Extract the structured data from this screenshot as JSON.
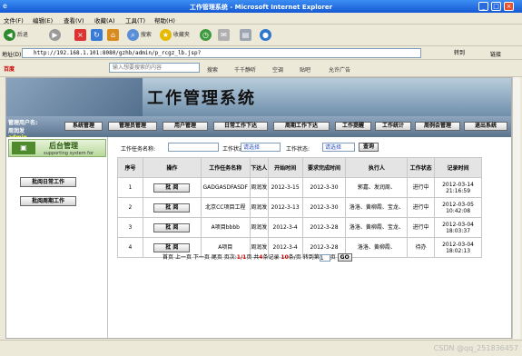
{
  "window": {
    "title": "工作管理系统 - Microsoft Internet Explorer",
    "controls": [
      "_",
      "□",
      "×"
    ]
  },
  "menu": [
    "文件(F)",
    "编辑(E)",
    "查看(V)",
    "收藏(A)",
    "工具(T)",
    "帮助(H)"
  ],
  "toolbar": {
    "back": "后退",
    "search": "搜索",
    "favorites": "收藏夹"
  },
  "address": {
    "label": "地址(D)",
    "url": "http://192.168.1.101:8080/gzhb/admin/p_rcgz_lb.jsp?",
    "go": "转到",
    "links": "链接"
  },
  "searchbar": {
    "brand": "百度",
    "placeholder": "输入想要搜索的内容",
    "items": [
      "搜索",
      "千千静听",
      "空调",
      "贴吧",
      "允许广告"
    ]
  },
  "app": {
    "title": "工作管理系统",
    "user_label": "管理用户名:",
    "user_role": "周润发",
    "user_name": "admin",
    "nav": [
      "系统管理",
      "管理员管理",
      "用户管理",
      "日常工作下达",
      "周期工作下达",
      "工作提醒",
      "工作统计",
      "周例会管理",
      "退出系统"
    ],
    "side": {
      "title": "后台管理",
      "subtitle": "supporting system for",
      "buttons": [
        "批阅日常工作",
        "批阅周期工作"
      ]
    },
    "filter": {
      "name_label": "工作任务名称:",
      "status1_label": "工作状态:",
      "status1_value": "请选择",
      "status2_label": "工作状态:",
      "status2_value": "请选择",
      "query": "查询"
    },
    "table": {
      "headers": [
        "序号",
        "操作",
        "工作任务名称",
        "下达人",
        "开始时间",
        "要求完成时间",
        "执行人",
        "工作状态",
        "记录时间"
      ],
      "action_label": "批 阅",
      "rows": [
        {
          "no": "1",
          "name": "GADGASDFASDF",
          "issuer": "周润发",
          "start": "2012-3-15",
          "due": "2012-3-30",
          "exec": "郭嘉、发润周、",
          "status": "进行中",
          "record": "2012-03-14 21:16:59"
        },
        {
          "no": "2",
          "name": "北京CC项目工程",
          "issuer": "周润发",
          "start": "2012-3-13",
          "due": "2012-3-30",
          "exec": "洛洛、黄柳霞、宝龙、",
          "status": "进行中",
          "record": "2012-03-05 10:42:08"
        },
        {
          "no": "3",
          "name": "A项目bbbb",
          "issuer": "周润发",
          "start": "2012-3-4",
          "due": "2012-3-28",
          "exec": "洛洛、黄柳霞、宝龙、",
          "status": "进行中",
          "record": "2012-03-04 18:03:37"
        },
        {
          "no": "4",
          "name": "A项目",
          "issuer": "周润发",
          "start": "2012-3-4",
          "due": "2012-3-28",
          "exec": "洛洛、黄柳霞、",
          "status": "待办",
          "record": "2012-03-04 18:02:13"
        }
      ]
    },
    "pager": {
      "first": "首页",
      "prev": "上一页",
      "next": "下一页",
      "last": "尾页",
      "page_label": "页次:",
      "page": "1/1",
      "page_unit": "页",
      "total_label": "共",
      "total": "4",
      "total_unit": "条记录",
      "per_page": "10",
      "per_page_unit": "条/页",
      "goto_label": "转到第",
      "goto_value": "1",
      "goto_unit": "页",
      "go": "GO"
    }
  },
  "watermark": "CSDN @qq_251836457"
}
